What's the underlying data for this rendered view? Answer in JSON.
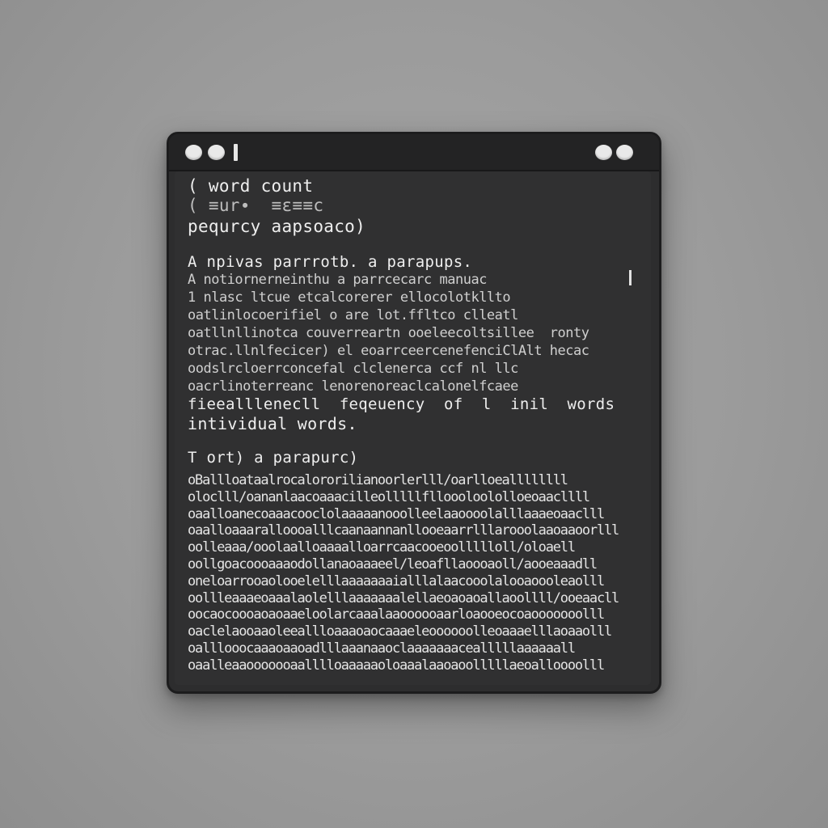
{
  "window": {
    "title_dots": [
      "traffic-dot-1",
      "traffic-dot-2"
    ],
    "right_dots": [
      "window-dot-1",
      "window-dot-2"
    ]
  },
  "header": {
    "line1": "( word count",
    "line2": "( ≡ur∙  ≡ɛ≡≡c",
    "line3": "pequrcy aapsoaco)"
  },
  "intro": {
    "line1": "A npivas parrrotb. a parapups.",
    "line2": "A notiornerneinthu a parrcecarc manuac",
    "line3": "1 nlasc ltcue etcalcorerer ellocolotkllto",
    "line4": "oatlinlocoerifiel o are lot.ffltco clleatl",
    "line5": "oatllnllinotca couverreartn ooeleecoltsillee  ronty",
    "line6": "otrac.llnlfecicer) el eoarrceercenefenciClAlt hecac",
    "line7": "oodslrcloerrconcefal clclenerca ccf nl llc",
    "line8": "oacrlinoterreanc lenorenoreaclcalonelfcaee",
    "line9": "fieealllenecll  feqeuency  of  l  inil  words",
    "line10": "intividual words."
  },
  "section2": {
    "heading": "T ort) a parapurc)"
  },
  "noise_lines": [
    "oBallloataalrocalororilianoorlerlll/oarlloeallllllll",
    "oloclll/oananlaacoaaacilleolllllflloooloololloeoaacllll",
    "oaalloanecoaaacooclolaaaaanooolleelaaoooolalllaaaeoaaclll",
    "oaalloaaaralloooalllcaanaannanllooeaarrlllarooolaaoaaoorlll",
    "oolleaaa/ooolaalloaaaalloarrcaacooeoollllloll/oloaell",
    "oollgoacoooaaaodollanaoaaaeel/leoafllaoooaoll/aooeaaadll",
    "oneloarrooaolooelelllaaaaaaaialllalaacooolalooaoooleaolll",
    "oollleaaaeoaaalaolelllaaaaaaalellaeoaoaoallaoollll/ooeaacll",
    "oocaocoooaoaoaaeloolarcaaalaaoooooaarloaooeocoaooooooolll",
    "oaclelaooaaoleeallloaaaoaocaaaeleoooooolleoaaaelllaoaaolll",
    "oalllooocaaaoaaoadlllaaanaaoclaaaaaaacealllllaaaaaall",
    "oaalleaaooooooaalllloaaaaaoloaaalaaoaoolllllaeoalloooolll"
  ]
}
